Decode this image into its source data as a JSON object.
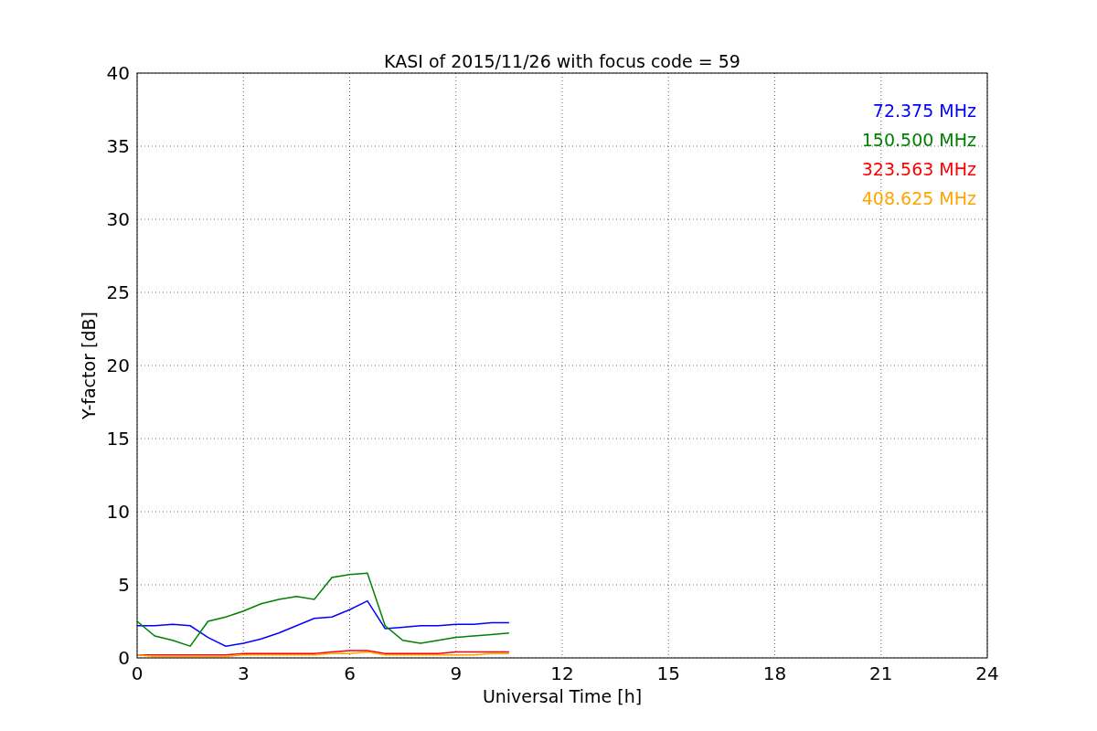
{
  "chart_data": {
    "type": "line",
    "title": "KASI of 2015/11/26 with focus code = 59",
    "xlabel": "Universal Time [h]",
    "ylabel": "Y-factor [dB]",
    "x": [
      0,
      0.5,
      1,
      1.5,
      2,
      2.5,
      3,
      3.5,
      4,
      4.5,
      5,
      5.5,
      6,
      6.5,
      7,
      7.5,
      8,
      8.5,
      9,
      9.5,
      10,
      10.5
    ],
    "series": [
      {
        "name": "72.375 MHz",
        "color": "#0000ff",
        "values": [
          2.2,
          2.2,
          2.3,
          2.2,
          1.4,
          0.8,
          1.0,
          1.3,
          1.7,
          2.2,
          2.7,
          2.8,
          3.3,
          3.9,
          2.0,
          2.1,
          2.2,
          2.2,
          2.3,
          2.3,
          2.4,
          2.4
        ]
      },
      {
        "name": "150.500 MHz",
        "color": "#008000",
        "values": [
          2.5,
          1.5,
          1.2,
          0.8,
          2.5,
          2.8,
          3.2,
          3.7,
          4.0,
          4.2,
          4.0,
          5.5,
          5.7,
          5.8,
          2.2,
          1.2,
          1.0,
          1.2,
          1.4,
          1.5,
          1.6,
          1.7
        ]
      },
      {
        "name": "323.563 MHz",
        "color": "#ff0000",
        "values": [
          0.2,
          0.2,
          0.2,
          0.2,
          0.2,
          0.2,
          0.3,
          0.3,
          0.3,
          0.3,
          0.3,
          0.4,
          0.5,
          0.5,
          0.3,
          0.3,
          0.3,
          0.3,
          0.4,
          0.4,
          0.4,
          0.4
        ]
      },
      {
        "name": "408.625 MHz",
        "color": "#ffa500",
        "values": [
          0.2,
          0.1,
          0.1,
          0.1,
          0.1,
          0.1,
          0.2,
          0.2,
          0.2,
          0.2,
          0.2,
          0.3,
          0.3,
          0.4,
          0.2,
          0.2,
          0.2,
          0.2,
          0.2,
          0.2,
          0.3,
          0.3
        ]
      }
    ],
    "xlim": [
      0,
      24
    ],
    "ylim": [
      0,
      40
    ],
    "xticks": [
      0,
      3,
      6,
      9,
      12,
      15,
      18,
      21,
      24
    ],
    "yticks": [
      0,
      5,
      10,
      15,
      20,
      25,
      30,
      35,
      40
    ],
    "grid": true
  }
}
